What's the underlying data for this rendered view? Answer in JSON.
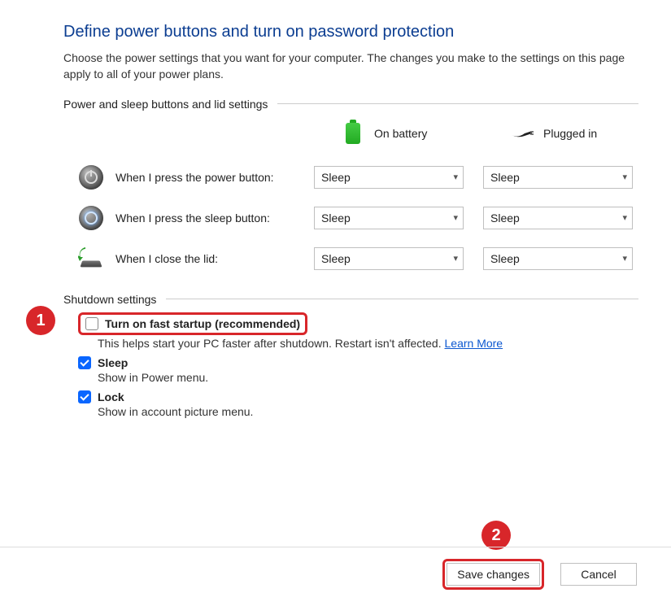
{
  "title": "Define power buttons and turn on password protection",
  "intro": "Choose the power settings that you want for your computer. The changes you make to the settings on this page apply to all of your power plans.",
  "sections": {
    "buttons_lid": {
      "header": "Power and sleep buttons and lid settings",
      "cols": {
        "battery": "On battery",
        "plugged": "Plugged in"
      },
      "rows": {
        "power": {
          "label": "When I press the power button:",
          "battery": "Sleep",
          "plugged": "Sleep"
        },
        "sleep": {
          "label": "When I press the sleep button:",
          "battery": "Sleep",
          "plugged": "Sleep"
        },
        "lid": {
          "label": "When I close the lid:",
          "battery": "Sleep",
          "plugged": "Sleep"
        }
      }
    },
    "shutdown": {
      "header": "Shutdown settings",
      "items": {
        "fast_startup": {
          "checked": false,
          "label": "Turn on fast startup (recommended)",
          "desc": "This helps start your PC faster after shutdown. Restart isn't affected. ",
          "link": "Learn More"
        },
        "sleep": {
          "checked": true,
          "label": "Sleep",
          "desc": "Show in Power menu."
        },
        "lock": {
          "checked": true,
          "label": "Lock",
          "desc": "Show in account picture menu."
        }
      }
    }
  },
  "footer": {
    "save": "Save changes",
    "cancel": "Cancel"
  },
  "annotations": {
    "one": "1",
    "two": "2"
  }
}
